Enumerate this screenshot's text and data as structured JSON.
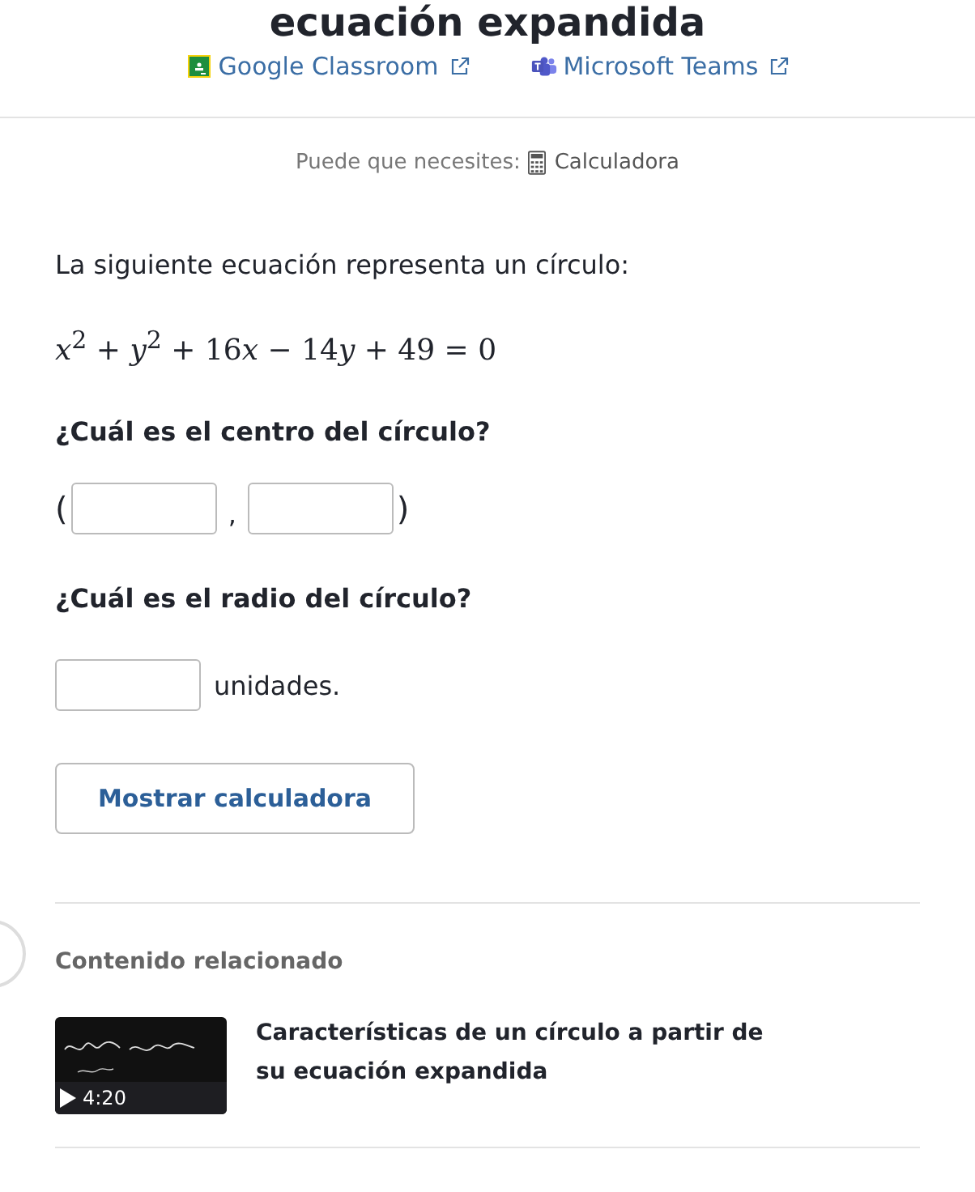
{
  "title": "ecuación expandida",
  "share_links": [
    {
      "kind": "classroom",
      "label": "Google Classroom"
    },
    {
      "kind": "teams",
      "label": "Microsoft Teams"
    }
  ],
  "tools": {
    "prefix": "Puede que necesites:",
    "label": "Calculadora"
  },
  "prompt": "La siguiente ecuación representa un círculo:",
  "equation": [
    {
      "kind": "var",
      "text": "x"
    },
    {
      "kind": "sup",
      "text": "2"
    },
    {
      "kind": "num",
      "text": " + "
    },
    {
      "kind": "var",
      "text": "y"
    },
    {
      "kind": "sup",
      "text": "2"
    },
    {
      "kind": "num",
      "text": " + 16"
    },
    {
      "kind": "var",
      "text": "x"
    },
    {
      "kind": "num",
      "text": " − 14"
    },
    {
      "kind": "var",
      "text": "y"
    },
    {
      "kind": "num",
      "text": " + 49 = 0"
    }
  ],
  "question_center": "¿Cuál es el centro del círculo?",
  "center_parts": {
    "open": "(",
    "comma": ",",
    "close": ")"
  },
  "question_radius": "¿Cuál es el radio del círculo?",
  "radius_unit": "unidades.",
  "calculator_button": "Mostrar calculadora",
  "related": {
    "heading": "Contenido relacionado",
    "items": [
      {
        "kind": "video",
        "duration": "4:20",
        "title": "Características de un círculo a partir de su ecuación expandida"
      }
    ]
  }
}
